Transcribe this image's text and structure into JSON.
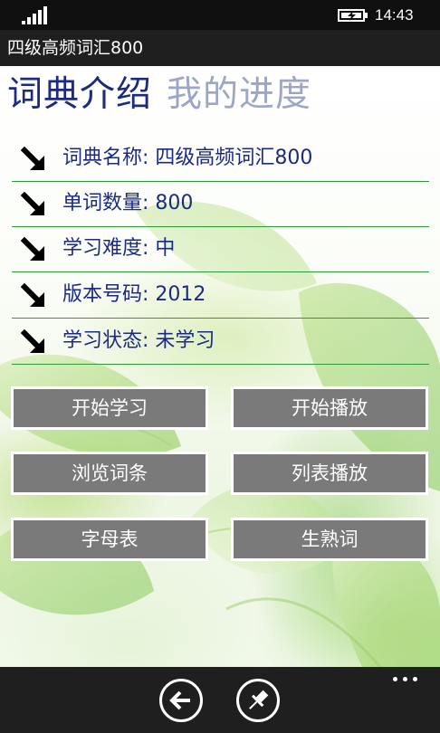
{
  "status_bar": {
    "time": "14:43",
    "signal_bars": 5
  },
  "app": {
    "title": "四级高频词汇800"
  },
  "pivot": {
    "active": "词典介绍",
    "inactive": "我的进度"
  },
  "info": {
    "items": [
      {
        "label": "词典名称: 四级高频词汇800"
      },
      {
        "label": "单词数量: 800"
      },
      {
        "label": "学习难度: 中"
      },
      {
        "label": "版本号码: 2012"
      },
      {
        "label": "学习状态: 未学习"
      }
    ]
  },
  "buttons": {
    "start_learning": "开始学习",
    "start_playback": "开始播放",
    "browse_entries": "浏览词条",
    "list_playback": "列表播放",
    "alphabet": "字母表",
    "new_familiar_words": "生熟词"
  },
  "app_bar": {
    "back_icon": "back-arrow-icon",
    "pin_icon": "pin-icon",
    "more_icon": "ellipsis-icon"
  },
  "colors": {
    "heading_blue": "#1c2a80",
    "inactive_pivot": "#9ea6c8",
    "divider_green": "#2f9a3a",
    "button_gray": "#7a7a7a",
    "chrome_dark": "#1f1f1f"
  }
}
